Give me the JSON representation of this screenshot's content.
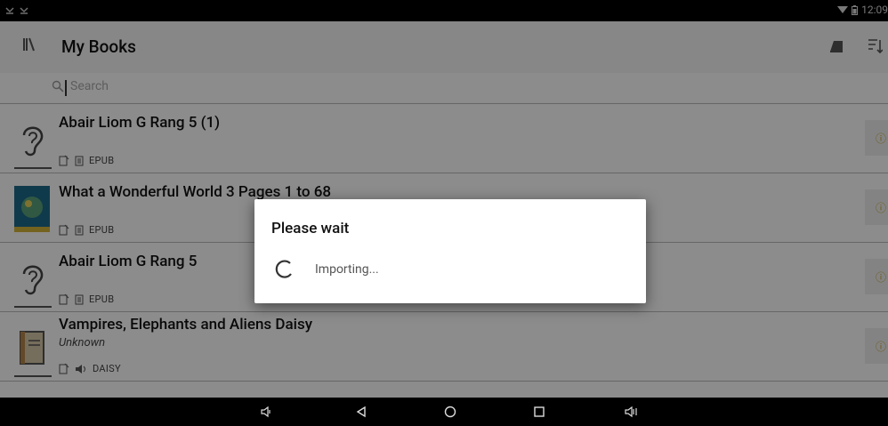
{
  "status_bar": {
    "time": "12:09"
  },
  "header": {
    "title": "My Books"
  },
  "search": {
    "placeholder": "Search"
  },
  "books": [
    {
      "title": "Abair Liom G Rang 5 (1)",
      "author": "",
      "format": "EPUB",
      "type": "audio"
    },
    {
      "title": "What a Wonderful World 3 Pages 1 to 68",
      "author": "",
      "format": "EPUB",
      "type": "cover"
    },
    {
      "title": "Abair Liom G Rang 5",
      "author": "",
      "format": "EPUB",
      "type": "audio"
    },
    {
      "title": "Vampires, Elephants and Aliens Daisy",
      "author": "Unknown",
      "format": "DAISY",
      "type": "book"
    }
  ],
  "dialog": {
    "title": "Please wait",
    "message": "Importing..."
  },
  "colors": {
    "accent": "#c7a020",
    "dim_overlay": "rgba(0,0,0,0.45)"
  }
}
